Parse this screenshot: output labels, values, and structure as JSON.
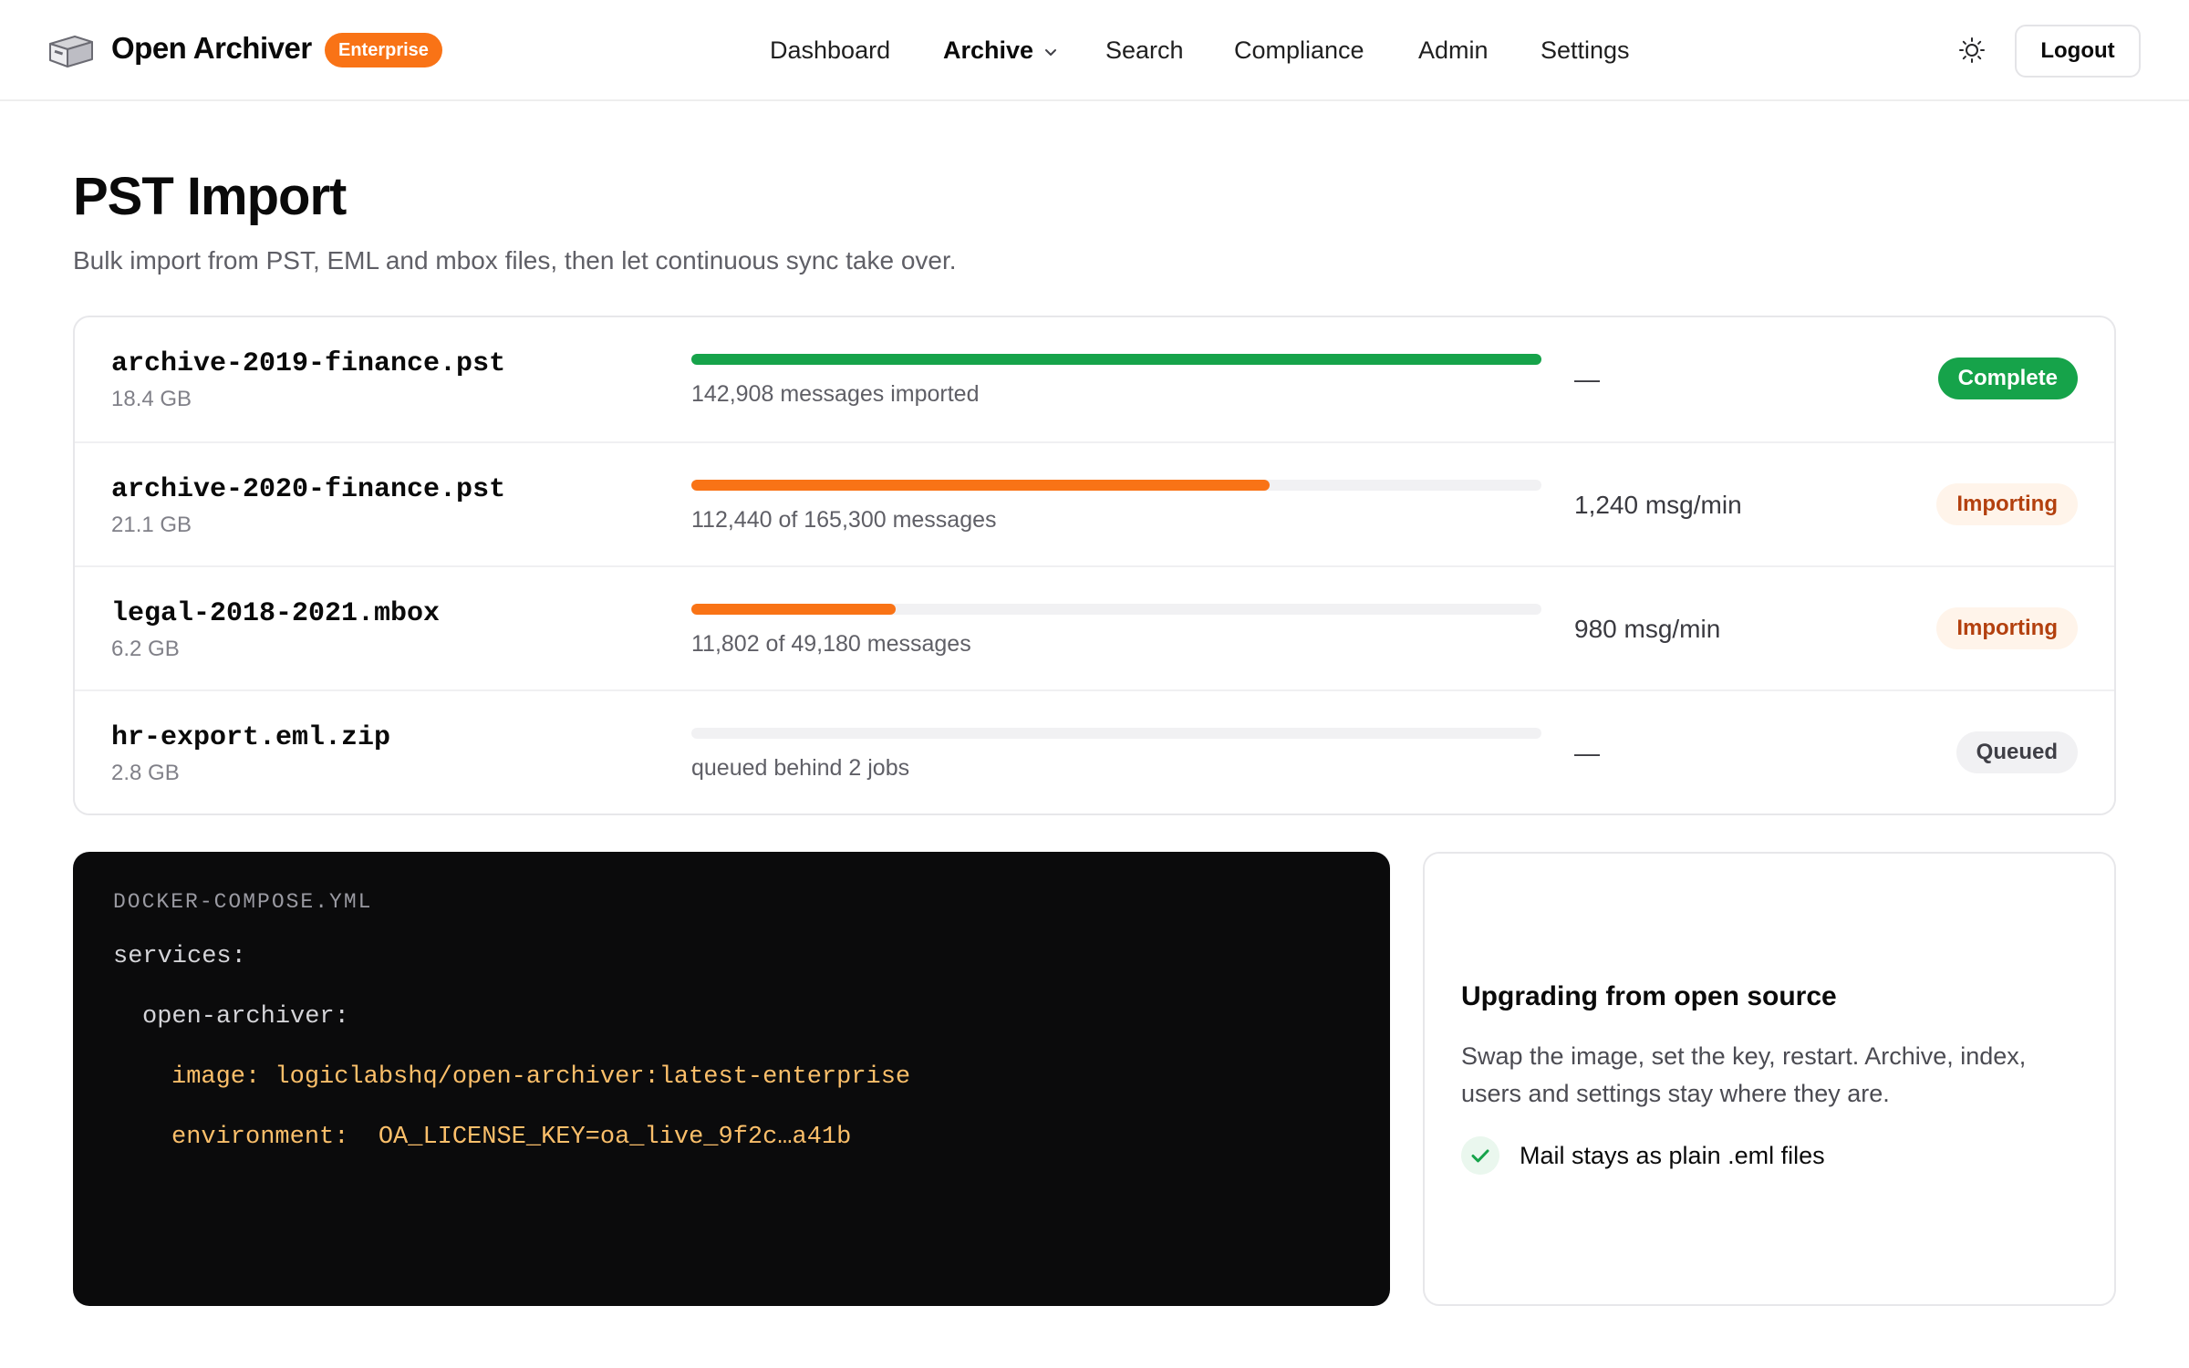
{
  "header": {
    "brand": "Open Archiver",
    "badge": "Enterprise",
    "nav": [
      {
        "label": "Dashboard"
      },
      {
        "label": "Archive"
      },
      {
        "label": "Search"
      },
      {
        "label": "Compliance"
      },
      {
        "label": "Admin"
      },
      {
        "label": "Settings"
      }
    ],
    "active_nav": "Archive",
    "theme_icon": "sun-icon",
    "logout_label": "Logout"
  },
  "page": {
    "title": "PST Import",
    "subtitle": "Bulk import from PST, EML and mbox files, then let continuous sync take over."
  },
  "imports": [
    {
      "file": "archive-2019-finance.pst",
      "size": "18.4 GB",
      "progress": 1.0,
      "color": "#16a34a",
      "messages": "142,908 messages imported",
      "rate": "—",
      "status": "Complete"
    },
    {
      "file": "archive-2020-finance.pst",
      "size": "21.1 GB",
      "progress": 0.68,
      "color": "#f97316",
      "messages": "112,440 of 165,300 messages",
      "rate": "1,240 msg/min",
      "status": "Importing"
    },
    {
      "file": "legal-2018-2021.mbox",
      "size": "6.2 GB",
      "progress": 0.24,
      "color": "#f97316",
      "messages": "11,802 of 49,180 messages",
      "rate": "980 msg/min",
      "status": "Importing"
    },
    {
      "file": "hr-export.eml.zip",
      "size": "2.8 GB",
      "progress": 0.0,
      "color": "#f97316",
      "messages": "queued behind 2 jobs",
      "rate": "—",
      "status": "Queued"
    }
  ],
  "code": {
    "title": "DOCKER-COMPOSE.YML",
    "line1": "services:",
    "line2": "open-archiver:",
    "line3_key": "image:",
    "line3_val": "logiclabshq/open-archiver:latest-enterprise",
    "line4_key": "environment:",
    "line4_val": "OA_LICENSE_KEY=oa_live_9f2c…a41b"
  },
  "upgrade": {
    "title": "Upgrading from open source",
    "body": "Swap the image, set the key, restart. Archive, index, users and settings stay where they are.",
    "check_label": "Mail stays as plain .eml files"
  },
  "colors": {
    "accent": "#f97316",
    "success": "#16a34a",
    "importing_text": "#b3400e"
  }
}
